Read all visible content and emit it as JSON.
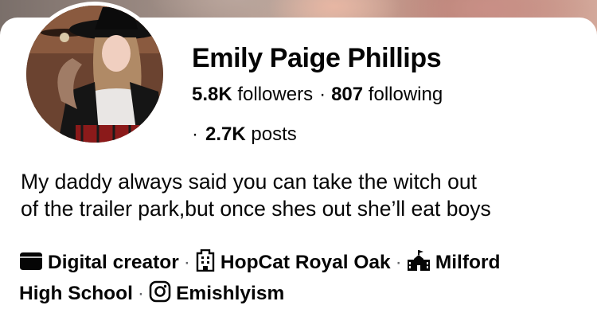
{
  "profile": {
    "name": "Emily Paige Phillips",
    "followers_count": "5.8K",
    "followers_label": "followers",
    "following_count": "807",
    "following_label": "following",
    "posts_count": "2.7K",
    "posts_label": "posts",
    "separator": "·",
    "bio_lines": [
      "My daddy always said you can take the witch out",
      "of the trailer park,but once shes out she’ll eat boys"
    ]
  },
  "details": [
    {
      "icon": "briefcase-icon",
      "text": "Digital creator"
    },
    {
      "icon": "building-icon",
      "text": "HopCat Royal Oak"
    },
    {
      "icon": "school-icon",
      "text_line1": "Milford",
      "text_line2": "High School"
    },
    {
      "icon": "instagram-icon",
      "text": "Emishlyism"
    }
  ],
  "colors": {
    "text": "#050505",
    "secondary": "#65676b",
    "card": "#ffffff"
  }
}
